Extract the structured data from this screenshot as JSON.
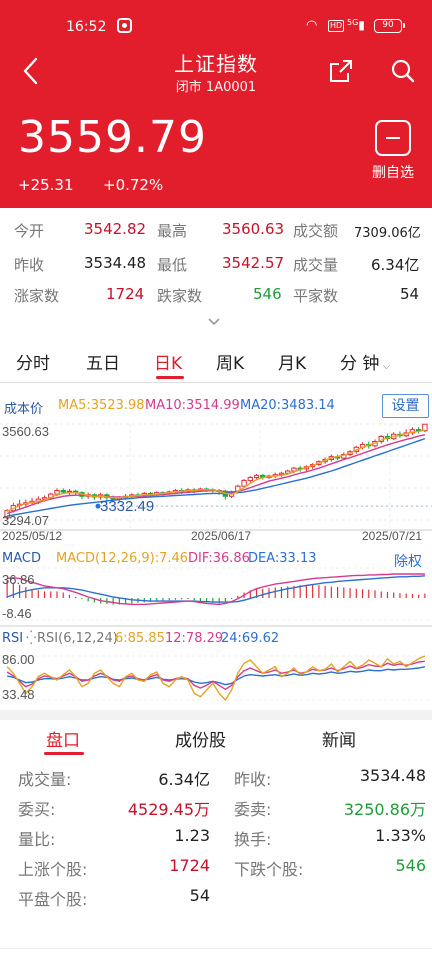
{
  "status_bar": {
    "time": "16:52",
    "network": "5G",
    "battery": "90"
  },
  "header": {
    "title": "上证指数",
    "subtitle": "闭市 1A0001",
    "price": "3559.79",
    "change": "+25.31",
    "change_pct": "+0.72%",
    "fav_label": "删自选"
  },
  "stats": [
    [
      {
        "label": "今开",
        "value": "3542.82",
        "color": "red"
      },
      {
        "label": "最高",
        "value": "3560.63",
        "color": "red"
      },
      {
        "label": "成交额",
        "value": "7309.06亿",
        "color": "dark"
      }
    ],
    [
      {
        "label": "昨收",
        "value": "3534.48",
        "color": "dark"
      },
      {
        "label": "最低",
        "value": "3542.57",
        "color": "red"
      },
      {
        "label": "成交量",
        "value": "6.34亿",
        "color": "dark"
      }
    ],
    [
      {
        "label": "涨家数",
        "value": "1724",
        "color": "red"
      },
      {
        "label": "跌家数",
        "value": "546",
        "color": "green"
      },
      {
        "label": "平家数",
        "value": "54",
        "color": "dark"
      }
    ]
  ],
  "period_tabs": {
    "items": [
      "分时",
      "五日",
      "日K",
      "周K",
      "月K",
      "分 钟"
    ],
    "active": 2
  },
  "ma_bar": {
    "label": "成本价",
    "ma5": "MA5:3523.98",
    "ma10": "MA10:3514.99",
    "ma20": "MA20:3483.14",
    "settings": "设置"
  },
  "macd": {
    "label": "MACD",
    "params": "MACD(12,26,9):7.46",
    "dif": "DIF:36.86",
    "dea": "DEA:33.13",
    "fq": "除权",
    "top": "36.86",
    "bottom": "-8.46"
  },
  "rsi": {
    "label": "RSI",
    "params": "RSI(6,12,24)",
    "r6": "6:85.85",
    "r12": "12:78.29",
    "r24": "24:69.62",
    "top": "86.00",
    "bottom": "33.48"
  },
  "colors": {
    "brand_red": "#e21d2c",
    "up": "#e0303c",
    "down": "#19a83a",
    "ma5": "#e4a323",
    "ma10": "#d53c8d",
    "ma20": "#2c6fd0"
  },
  "chart_data": {
    "type": "candlestick",
    "x_labels": [
      "2025/05/12",
      "2025/06/17",
      "2025/07/21"
    ],
    "y_max_label": "3560.63",
    "y_min_label": "3294.07",
    "ylim": [
      3294.07,
      3560.63
    ],
    "cost_price": "3332.49",
    "candles": [
      [
        3300,
        3320,
        3296,
        3324
      ],
      [
        3320,
        3334,
        3315,
        3342
      ],
      [
        3334,
        3338,
        3326,
        3350
      ],
      [
        3338,
        3342,
        3330,
        3351
      ],
      [
        3342,
        3346,
        3335,
        3356
      ],
      [
        3346,
        3352,
        3338,
        3360
      ],
      [
        3352,
        3356,
        3345,
        3362
      ],
      [
        3356,
        3366,
        3350,
        3370
      ],
      [
        3366,
        3376,
        3360,
        3382
      ],
      [
        3376,
        3372,
        3366,
        3382
      ],
      [
        3372,
        3374,
        3364,
        3380
      ],
      [
        3374,
        3370,
        3362,
        3378
      ],
      [
        3370,
        3360,
        3352,
        3374
      ],
      [
        3360,
        3364,
        3353,
        3370
      ],
      [
        3364,
        3358,
        3350,
        3368
      ],
      [
        3358,
        3364,
        3350,
        3370
      ],
      [
        3364,
        3356,
        3348,
        3368
      ],
      [
        3356,
        3352,
        3344,
        3362
      ],
      [
        3352,
        3356,
        3346,
        3360
      ],
      [
        3356,
        3360,
        3350,
        3366
      ],
      [
        3360,
        3364,
        3354,
        3368
      ],
      [
        3364,
        3362,
        3356,
        3370
      ],
      [
        3362,
        3368,
        3358,
        3372
      ],
      [
        3368,
        3364,
        3358,
        3372
      ],
      [
        3364,
        3370,
        3360,
        3374
      ],
      [
        3370,
        3368,
        3362,
        3374
      ],
      [
        3368,
        3372,
        3364,
        3376
      ],
      [
        3372,
        3376,
        3368,
        3380
      ],
      [
        3376,
        3374,
        3366,
        3382
      ],
      [
        3374,
        3378,
        3370,
        3382
      ],
      [
        3378,
        3376,
        3368,
        3382
      ],
      [
        3376,
        3380,
        3372,
        3384
      ],
      [
        3380,
        3378,
        3372,
        3384
      ],
      [
        3378,
        3376,
        3370,
        3382
      ],
      [
        3376,
        3374,
        3364,
        3380
      ],
      [
        3374,
        3360,
        3350,
        3378
      ],
      [
        3360,
        3372,
        3355,
        3376
      ],
      [
        3372,
        3388,
        3370,
        3392
      ],
      [
        3388,
        3404,
        3384,
        3408
      ],
      [
        3404,
        3412,
        3398,
        3416
      ],
      [
        3412,
        3418,
        3406,
        3422
      ],
      [
        3418,
        3412,
        3406,
        3422
      ],
      [
        3412,
        3416,
        3408,
        3420
      ],
      [
        3416,
        3420,
        3410,
        3426
      ],
      [
        3420,
        3424,
        3414,
        3428
      ],
      [
        3424,
        3430,
        3420,
        3434
      ],
      [
        3430,
        3438,
        3424,
        3442
      ],
      [
        3438,
        3436,
        3428,
        3444
      ],
      [
        3436,
        3442,
        3430,
        3446
      ],
      [
        3442,
        3448,
        3436,
        3452
      ],
      [
        3448,
        3456,
        3444,
        3460
      ],
      [
        3456,
        3462,
        3450,
        3468
      ],
      [
        3462,
        3470,
        3456,
        3476
      ],
      [
        3470,
        3466,
        3460,
        3476
      ],
      [
        3466,
        3476,
        3462,
        3482
      ],
      [
        3476,
        3484,
        3472,
        3488
      ],
      [
        3484,
        3496,
        3478,
        3500
      ],
      [
        3496,
        3504,
        3490,
        3510
      ],
      [
        3504,
        3500,
        3492,
        3512
      ],
      [
        3500,
        3512,
        3496,
        3518
      ],
      [
        3512,
        3526,
        3506,
        3530
      ],
      [
        3526,
        3520,
        3512,
        3534
      ],
      [
        3520,
        3532,
        3516,
        3538
      ],
      [
        3532,
        3528,
        3522,
        3540
      ],
      [
        3528,
        3536,
        3524,
        3546
      ],
      [
        3536,
        3545,
        3530,
        3552
      ],
      [
        3545,
        3542,
        3534,
        3552
      ],
      [
        3542,
        3560,
        3538,
        3560
      ]
    ],
    "ma5": [
      3318,
      3326,
      3334,
      3340,
      3343,
      3346,
      3350,
      3356,
      3364,
      3368,
      3370,
      3370,
      3366,
      3362,
      3360,
      3360,
      3358,
      3356,
      3356,
      3358,
      3360,
      3362,
      3364,
      3364,
      3366,
      3368,
      3370,
      3372,
      3374,
      3376,
      3376,
      3378,
      3378,
      3378,
      3374,
      3368,
      3366,
      3372,
      3384,
      3396,
      3406,
      3412,
      3414,
      3416,
      3418,
      3422,
      3428,
      3434,
      3440,
      3446,
      3452,
      3460,
      3466,
      3470,
      3474,
      3480,
      3488,
      3496,
      3502,
      3508,
      3516,
      3522,
      3526,
      3530,
      3534,
      3538,
      3540,
      3544
    ],
    "ma10": [
      3312,
      3318,
      3324,
      3330,
      3336,
      3342,
      3348,
      3352,
      3356,
      3360,
      3362,
      3363,
      3363,
      3362,
      3361,
      3360,
      3359,
      3358,
      3358,
      3358,
      3359,
      3360,
      3361,
      3362,
      3364,
      3365,
      3366,
      3368,
      3370,
      3371,
      3372,
      3374,
      3375,
      3376,
      3375,
      3373,
      3372,
      3374,
      3378,
      3384,
      3390,
      3396,
      3402,
      3406,
      3410,
      3414,
      3419,
      3424,
      3428,
      3433,
      3438,
      3444,
      3450,
      3456,
      3462,
      3467,
      3473,
      3479,
      3485,
      3491,
      3497,
      3503,
      3508,
      3513,
      3518,
      3522,
      3527,
      3531
    ],
    "ma20": [
      3305,
      3308,
      3311,
      3314,
      3317,
      3320,
      3323,
      3326,
      3329,
      3332,
      3335,
      3337,
      3339,
      3341,
      3343,
      3345,
      3347,
      3349,
      3351,
      3353,
      3354,
      3356,
      3357,
      3358,
      3359,
      3360,
      3361,
      3362,
      3363,
      3364,
      3365,
      3366,
      3367,
      3368,
      3368,
      3368,
      3369,
      3370,
      3372,
      3375,
      3378,
      3382,
      3386,
      3390,
      3394,
      3398,
      3402,
      3406,
      3410,
      3415,
      3420,
      3425,
      3430,
      3436,
      3442,
      3448,
      3454,
      3460,
      3466,
      3472,
      3478,
      3484,
      3490,
      3496,
      3502,
      3508,
      3514,
      3520
    ],
    "macd_bars": [
      0.8,
      0.7,
      0.6,
      0.5,
      0.4,
      0.35,
      0.3,
      0.3,
      0.3,
      0.25,
      0.15,
      0.05,
      -0.05,
      -0.15,
      -0.2,
      -0.25,
      -0.28,
      -0.3,
      -0.3,
      -0.28,
      -0.25,
      -0.22,
      -0.2,
      -0.18,
      -0.15,
      -0.12,
      -0.1,
      -0.08,
      -0.06,
      -0.05,
      -0.1,
      -0.15,
      -0.2,
      -0.22,
      -0.25,
      -0.15,
      -0.05,
      0.1,
      0.25,
      0.35,
      0.4,
      0.42,
      0.45,
      0.48,
      0.5,
      0.52,
      0.55,
      0.58,
      0.6,
      0.6,
      0.58,
      0.55,
      0.52,
      0.5,
      0.48,
      0.45,
      0.42,
      0.4,
      0.38,
      0.35,
      0.3,
      0.28,
      0.25,
      0.22,
      0.2,
      0.18,
      0.15,
      0.2
    ],
    "dif": [
      0.9,
      0.92,
      0.9,
      0.86,
      0.82,
      0.78,
      0.74,
      0.72,
      0.7,
      0.68,
      0.64,
      0.6,
      0.55,
      0.5,
      0.46,
      0.42,
      0.4,
      0.38,
      0.36,
      0.35,
      0.34,
      0.34,
      0.34,
      0.35,
      0.36,
      0.37,
      0.38,
      0.39,
      0.4,
      0.41,
      0.4,
      0.38,
      0.36,
      0.35,
      0.34,
      0.36,
      0.4,
      0.46,
      0.54,
      0.62,
      0.68,
      0.72,
      0.75,
      0.78,
      0.8,
      0.82,
      0.84,
      0.86,
      0.88,
      0.9,
      0.91,
      0.92,
      0.93,
      0.94,
      0.95,
      0.96,
      0.97,
      0.97,
      0.98,
      0.98,
      0.99,
      0.99,
      1.0,
      1.0,
      1.0,
      1.0,
      1.0,
      1.0
    ],
    "dea": [
      0.5,
      0.55,
      0.6,
      0.63,
      0.66,
      0.68,
      0.7,
      0.7,
      0.7,
      0.7,
      0.69,
      0.67,
      0.65,
      0.62,
      0.59,
      0.56,
      0.53,
      0.5,
      0.48,
      0.46,
      0.44,
      0.43,
      0.42,
      0.41,
      0.41,
      0.41,
      0.41,
      0.41,
      0.41,
      0.41,
      0.41,
      0.4,
      0.4,
      0.39,
      0.39,
      0.39,
      0.39,
      0.4,
      0.43,
      0.47,
      0.51,
      0.55,
      0.59,
      0.62,
      0.65,
      0.68,
      0.7,
      0.73,
      0.75,
      0.77,
      0.79,
      0.81,
      0.82,
      0.84,
      0.85,
      0.86,
      0.87,
      0.88,
      0.89,
      0.9,
      0.91,
      0.92,
      0.93,
      0.94,
      0.94,
      0.95,
      0.95,
      0.96
    ],
    "rsi6": [
      70,
      60,
      45,
      30,
      40,
      55,
      60,
      55,
      50,
      58,
      65,
      55,
      40,
      45,
      60,
      65,
      55,
      45,
      40,
      55,
      60,
      50,
      48,
      58,
      62,
      45,
      40,
      50,
      55,
      50,
      30,
      25,
      35,
      45,
      30,
      20,
      35,
      60,
      75,
      80,
      70,
      60,
      65,
      70,
      55,
      60,
      68,
      58,
      62,
      70,
      64,
      66,
      74,
      62,
      70,
      78,
      68,
      72,
      80,
      75,
      70,
      82,
      74,
      78,
      70,
      76,
      82,
      86
    ],
    "rsi12": [
      62,
      56,
      48,
      40,
      44,
      52,
      56,
      54,
      52,
      56,
      60,
      55,
      48,
      50,
      56,
      60,
      56,
      50,
      48,
      54,
      56,
      52,
      50,
      55,
      58,
      50,
      48,
      52,
      54,
      52,
      42,
      38,
      42,
      48,
      42,
      36,
      42,
      55,
      64,
      68,
      64,
      60,
      62,
      65,
      60,
      62,
      65,
      60,
      62,
      66,
      64,
      65,
      68,
      64,
      67,
      71,
      67,
      69,
      73,
      71,
      70,
      75,
      72,
      74,
      72,
      74,
      77,
      78
    ],
    "rsi24": [
      56,
      54,
      50,
      46,
      47,
      50,
      52,
      52,
      51,
      53,
      55,
      53,
      50,
      50,
      53,
      55,
      54,
      51,
      50,
      52,
      53,
      51,
      50,
      52,
      54,
      51,
      50,
      51,
      52,
      51,
      47,
      45,
      46,
      48,
      46,
      43,
      45,
      51,
      56,
      58,
      57,
      56,
      57,
      58,
      56,
      57,
      59,
      57,
      58,
      60,
      59,
      60,
      62,
      60,
      61,
      63,
      62,
      63,
      65,
      64,
      64,
      66,
      65,
      66,
      66,
      67,
      68,
      70
    ]
  },
  "bottom_tabs": {
    "items": [
      "盘口",
      "成份股",
      "新闻"
    ],
    "active": 0
  },
  "details": [
    [
      {
        "label": "成交量:",
        "value": "6.34亿",
        "color": "dark"
      },
      {
        "label": "昨收:",
        "value": "3534.48",
        "color": "dark"
      }
    ],
    [
      {
        "label": "委买:",
        "value": "4529.45万",
        "color": "red"
      },
      {
        "label": "委卖:",
        "value": "3250.86万",
        "color": "green"
      }
    ],
    [
      {
        "label": "量比:",
        "value": "1.23",
        "color": "dark"
      },
      {
        "label": "换手:",
        "value": "1.33%",
        "color": "dark"
      }
    ],
    [
      {
        "label": "上涨个股:",
        "value": "1724",
        "color": "red"
      },
      {
        "label": "下跌个股:",
        "value": "546",
        "color": "green"
      }
    ],
    [
      {
        "label": "平盘个股:",
        "value": "54",
        "color": "dark"
      }
    ]
  ]
}
